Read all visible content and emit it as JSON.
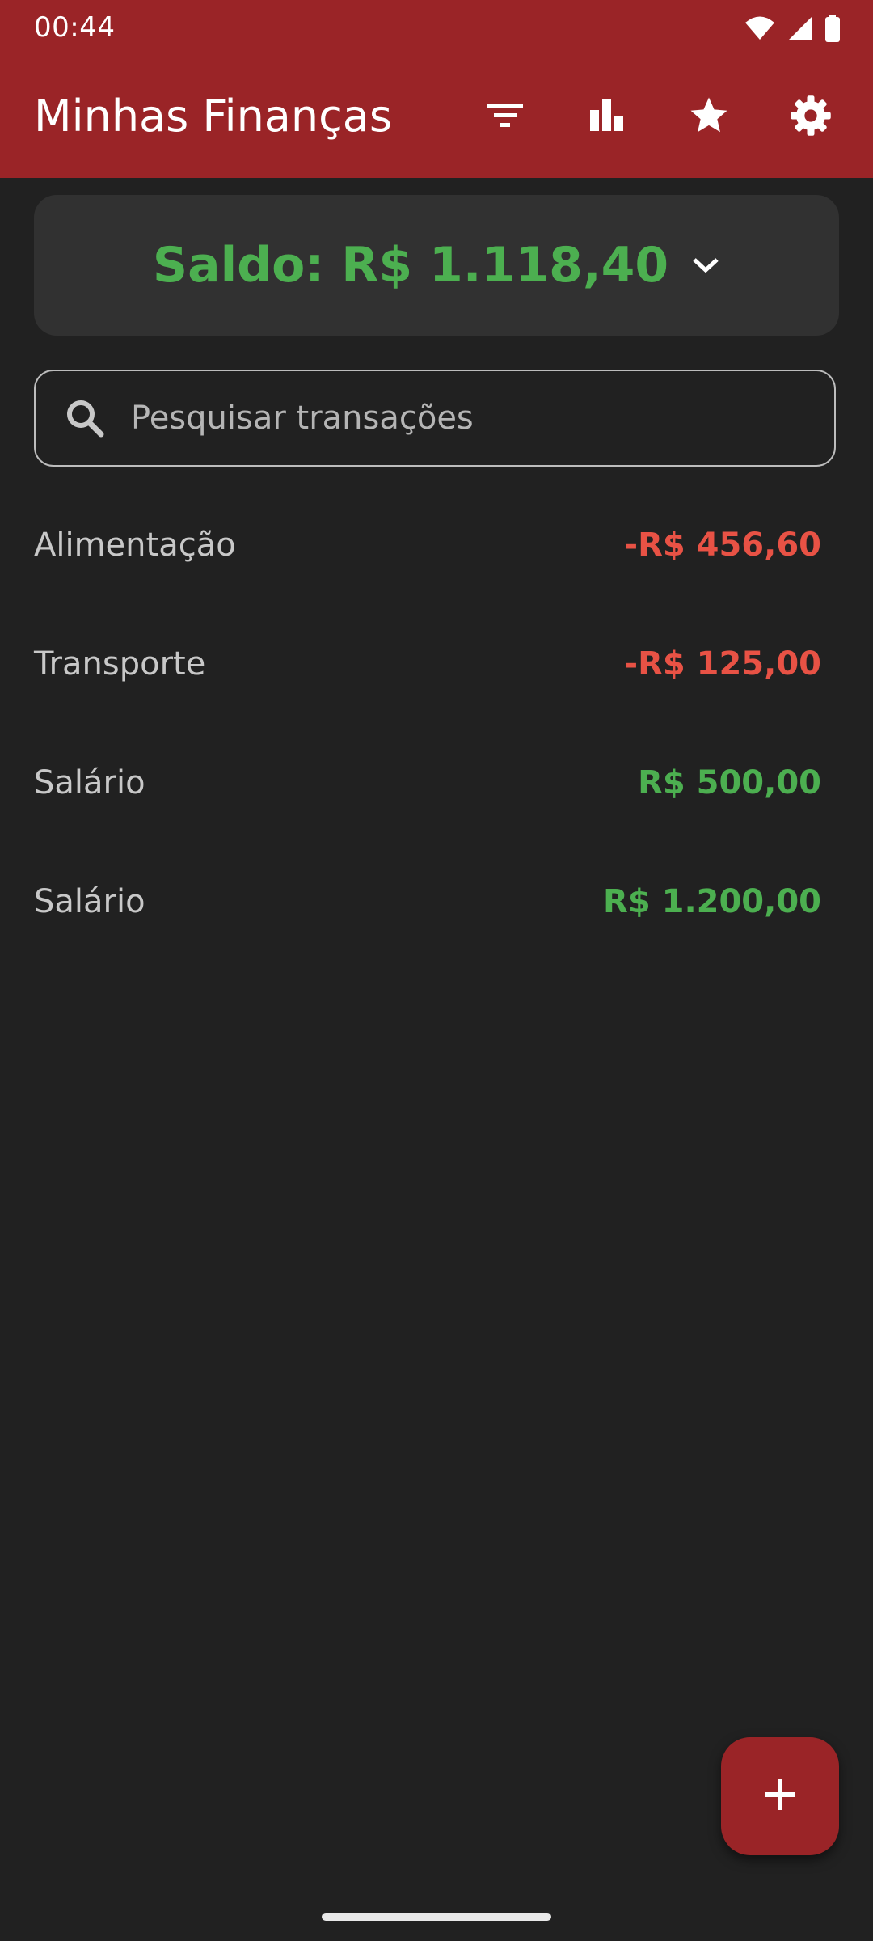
{
  "status_bar": {
    "time": "00:44",
    "icons": [
      "wifi-icon",
      "signal-icon",
      "battery-icon"
    ]
  },
  "app_bar": {
    "title": "Minhas Finanças",
    "actions": [
      "filter-icon",
      "bar-chart-icon",
      "star-icon",
      "gear-icon"
    ],
    "background": "#9a2427"
  },
  "balance": {
    "text": "Saldo: R$ 1.118,40",
    "color": "#4caf50"
  },
  "search": {
    "placeholder": "Pesquisar transações",
    "value": ""
  },
  "transactions": [
    {
      "name": "Alimentação",
      "amount": "-R$ 456,60",
      "type": "expense"
    },
    {
      "name": "Transporte",
      "amount": "-R$ 125,00",
      "type": "expense"
    },
    {
      "name": "Salário",
      "amount": "R$ 500,00",
      "type": "income"
    },
    {
      "name": "Salário",
      "amount": "R$ 1.200,00",
      "type": "income"
    }
  ],
  "colors": {
    "expense": "#e85245",
    "income": "#4caf50",
    "background": "#212121",
    "card": "#313131"
  },
  "fab": {
    "icon": "plus-icon"
  }
}
